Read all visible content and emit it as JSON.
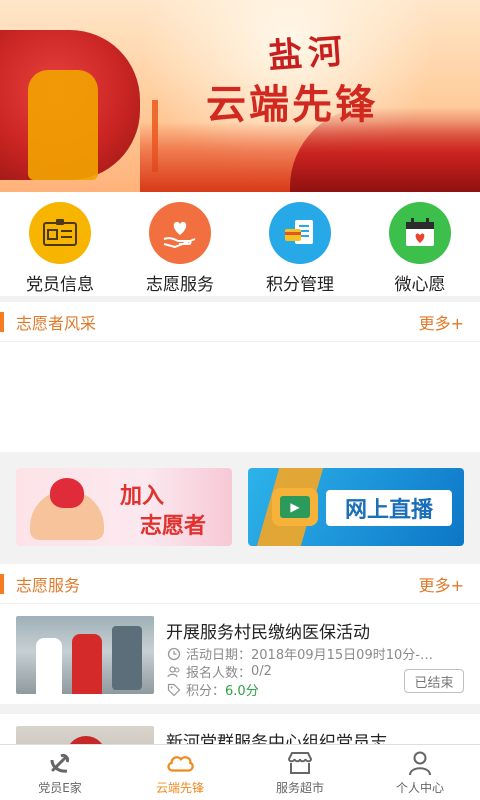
{
  "banner": {
    "calligraphy": "盐河",
    "title": "云端先锋"
  },
  "quick_nav": [
    {
      "label": "党员信息",
      "icon": "id-card-icon",
      "color": "#f7b500"
    },
    {
      "label": "志愿服务",
      "icon": "heart-hand-icon",
      "color": "#f2703f"
    },
    {
      "label": "积分管理",
      "icon": "wallet-card-icon",
      "color": "#27a9e8"
    },
    {
      "label": "微心愿",
      "icon": "wish-calendar-icon",
      "color": "#3cbf4b"
    }
  ],
  "volunteer_style": {
    "title": "志愿者风采",
    "more": "更多+"
  },
  "promo": {
    "join_line1": "加入",
    "join_line2": "志愿者",
    "live": "网上直播"
  },
  "volunteer_service": {
    "title": "志愿服务",
    "more": "更多+",
    "items": [
      {
        "title": "开展服务村民缴纳医保活动",
        "date_label": "活动日期：",
        "date_value": "2018年09月15日09时10分-…",
        "signup_label": "报名人数：",
        "signup_value": "0/2",
        "points_label": "积分：",
        "points_value": "6.0分",
        "status": "已结束"
      },
      {
        "title": "新河党群服务中心组织党员志…"
      }
    ]
  },
  "tabbar": [
    {
      "label": "党员E家",
      "icon": "party-emblem-icon",
      "active": false
    },
    {
      "label": "云端先锋",
      "icon": "cloud-icon",
      "active": true
    },
    {
      "label": "服务超市",
      "icon": "store-icon",
      "active": false
    },
    {
      "label": "个人中心",
      "icon": "person-icon",
      "active": false
    }
  ],
  "colors": {
    "accent": "#f08a1e",
    "section_text": "#e07a2b",
    "green_points": "#2ea043"
  }
}
